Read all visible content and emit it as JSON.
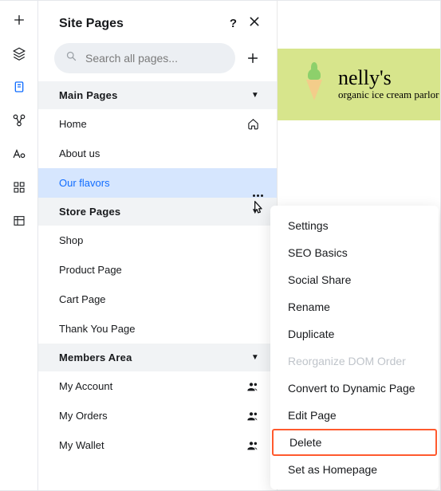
{
  "panel": {
    "title": "Site Pages",
    "search_placeholder": "Search all pages..."
  },
  "sections": [
    {
      "label": "Main Pages",
      "items": [
        {
          "label": "Home",
          "icon": "home"
        },
        {
          "label": "About us",
          "icon": null
        },
        {
          "label": "Our flavors",
          "icon": null,
          "selected": true
        }
      ]
    },
    {
      "label": "Store Pages",
      "items": [
        {
          "label": "Shop",
          "icon": null
        },
        {
          "label": "Product Page",
          "icon": null
        },
        {
          "label": "Cart Page",
          "icon": null
        },
        {
          "label": "Thank You Page",
          "icon": null
        }
      ]
    },
    {
      "label": "Members Area",
      "items": [
        {
          "label": "My Account",
          "icon": "members"
        },
        {
          "label": "My Orders",
          "icon": "members"
        },
        {
          "label": "My Wallet",
          "icon": "members"
        }
      ]
    }
  ],
  "context_menu": [
    {
      "label": "Settings"
    },
    {
      "label": "SEO Basics"
    },
    {
      "label": "Social Share"
    },
    {
      "label": "Rename"
    },
    {
      "label": "Duplicate"
    },
    {
      "label": "Reorganize DOM Order",
      "disabled": true
    },
    {
      "label": "Convert to Dynamic Page"
    },
    {
      "label": "Edit Page"
    },
    {
      "label": "Delete",
      "highlight": true
    },
    {
      "label": "Set as Homepage"
    }
  ],
  "hero": {
    "title": "nelly's",
    "subtitle": "organic ice cream parlor"
  }
}
